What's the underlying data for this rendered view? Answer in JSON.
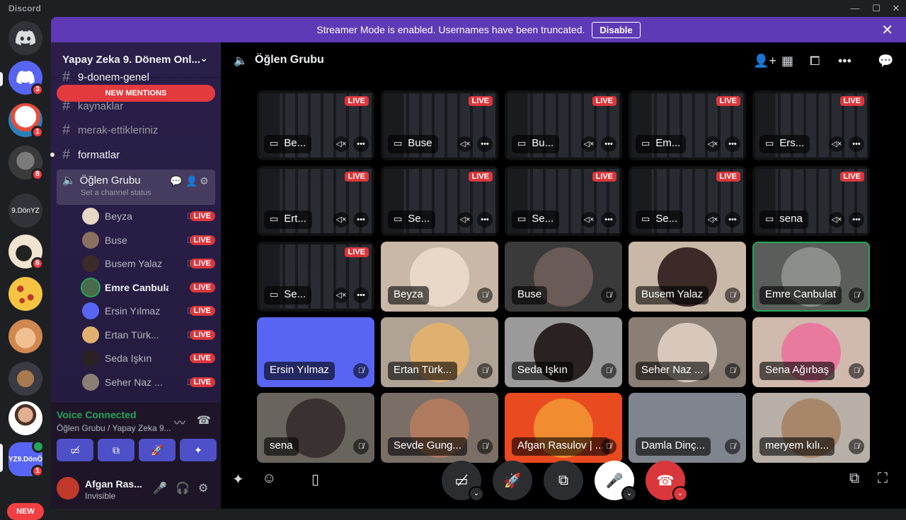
{
  "window": {
    "app_name": "Discord"
  },
  "banner": {
    "message": "Streamer Mode is enabled. Usernames have been truncated.",
    "disable_label": "Disable"
  },
  "servers": [
    {
      "label": "",
      "badge": "3"
    },
    {
      "label": "",
      "badge": "1"
    },
    {
      "label": "",
      "badge": "8"
    },
    {
      "label": "9.DönYZ",
      "badge": ""
    },
    {
      "label": "",
      "badge": "6"
    },
    {
      "label": "",
      "badge": ""
    },
    {
      "label": "",
      "badge": ""
    },
    {
      "label": "",
      "badge": ""
    },
    {
      "label": "",
      "badge": ""
    },
    {
      "label": "YZ9.DönÖ",
      "badge": "1"
    }
  ],
  "new_label": "NEW",
  "guild": {
    "name": "Yapay Zeka 9. Dönem Onl..."
  },
  "new_mentions": "NEW MENTIONS",
  "channels": [
    "9-donem-genel",
    "kaynaklar",
    "merak-ettikleriniz",
    "formatlar"
  ],
  "voice_channel": {
    "name": "Öğlen Grubu",
    "status": "Set a channel status"
  },
  "voice_users": [
    {
      "name": "Beyza",
      "live": "LIVE"
    },
    {
      "name": "Buse",
      "live": "LIVE"
    },
    {
      "name": "Busem Yalaz",
      "live": "LIVE"
    },
    {
      "name": "Emre Canbulat",
      "live": "LIVE"
    },
    {
      "name": "Ersin Yılmaz",
      "live": "LIVE"
    },
    {
      "name": "Ertan Türk...",
      "live": "LIVE"
    },
    {
      "name": "Seda Işkın",
      "live": "LIVE"
    },
    {
      "name": "Seher Naz ...",
      "live": "LIVE"
    }
  ],
  "voice_panel": {
    "title": "Voice Connected",
    "subtitle": "Öğlen Grubu / Yapay Zeka 9..."
  },
  "user": {
    "name": "Afgan Ras...",
    "status": "Invisible"
  },
  "stage": {
    "title": "Öğlen Grubu"
  },
  "screen_tiles": [
    {
      "name": "Be...",
      "live": "LIVE"
    },
    {
      "name": "Buse",
      "live": "LIVE"
    },
    {
      "name": "Bu...",
      "live": "LIVE"
    },
    {
      "name": "Em...",
      "live": "LIVE"
    },
    {
      "name": "Ers...",
      "live": "LIVE"
    },
    {
      "name": "Ert...",
      "live": "LIVE"
    },
    {
      "name": "Se...",
      "live": "LIVE"
    },
    {
      "name": "Se...",
      "live": "LIVE"
    },
    {
      "name": "Se...",
      "live": "LIVE"
    },
    {
      "name": "sena",
      "live": "LIVE"
    },
    {
      "name": "Se...",
      "live": "LIVE"
    }
  ],
  "cam_tiles": [
    {
      "name": "Beyza",
      "bg": "#c9b8a8",
      "face": "#e8d8c8"
    },
    {
      "name": "Buse",
      "bg": "#3a3a3a",
      "face": "#6a5a58"
    },
    {
      "name": "Busem Yalaz",
      "bg": "#c9b8a8",
      "face": "#3b2a28"
    },
    {
      "name": "Emre Canbulat",
      "bg": "#5a5e5a",
      "face": "#8b8f8a"
    },
    {
      "name": "Ersin Yılmaz",
      "bg": "#5865f2",
      "face": "#5865f2"
    },
    {
      "name": "Ertan Türk...",
      "bg": "#b0a294",
      "face": "#e0b070"
    },
    {
      "name": "Seda Işkın",
      "bg": "#9a9a9a",
      "face": "#2a2222"
    },
    {
      "name": "Seher Naz ...",
      "bg": "#8b7e74",
      "face": "#d8c8bc"
    },
    {
      "name": "Sena Ağırbaş",
      "bg": "#d0b9ad",
      "face": "#e87aa0"
    },
    {
      "name": "sena",
      "bg": "#6a645e",
      "face": "#3a3230"
    },
    {
      "name": "Sevde Gung...",
      "bg": "#7a6e66",
      "face": "#b07a5e"
    },
    {
      "name": "Afgan Rasulov | ...",
      "bg": "#e94a1f",
      "face": "#f28c30"
    },
    {
      "name": "Damla Dinç...",
      "bg": "#80848e",
      "face": "#80848e"
    },
    {
      "name": "meryem kılı...",
      "bg": "#b8b0a8",
      "face": "#a8866a"
    }
  ],
  "colors": {
    "accent": "#5865f2",
    "live": "#da373c",
    "banner": "#5f3ab6",
    "connected": "#23a55a",
    "hangup": "#da373c"
  }
}
